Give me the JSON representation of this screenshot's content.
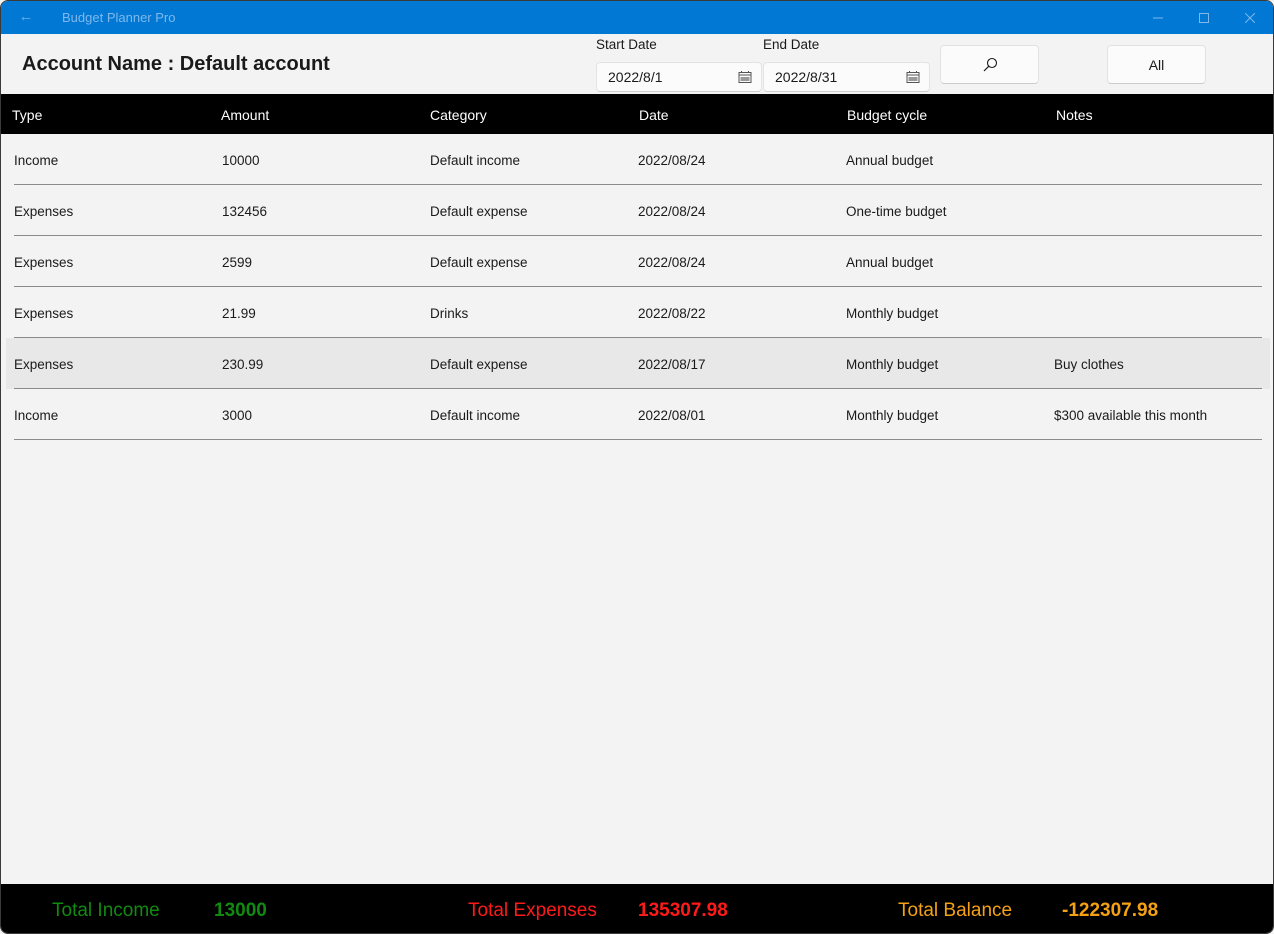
{
  "window": {
    "title": "Budget Planner Pro",
    "back_icon": "arrow-left-icon",
    "controls": [
      "minimize",
      "maximize",
      "close"
    ]
  },
  "header": {
    "account_title": "Account Name : Default account",
    "start_date": {
      "label": "Start Date",
      "value": "2022/8/1",
      "icon": "calendar-icon"
    },
    "end_date": {
      "label": "End Date",
      "value": "2022/8/31",
      "icon": "calendar-icon"
    },
    "search_button": {
      "icon": "search-icon"
    },
    "all_button": {
      "label": "All"
    }
  },
  "table": {
    "columns": [
      "Type",
      "Amount",
      "Category",
      "Date",
      "Budget cycle",
      "Notes"
    ],
    "rows": [
      {
        "type": "Income",
        "amount": "10000",
        "category": "Default income",
        "date": "2022/08/24",
        "cycle": "Annual budget",
        "notes": ""
      },
      {
        "type": "Expenses",
        "amount": "132456",
        "category": "Default expense",
        "date": "2022/08/24",
        "cycle": "One-time budget",
        "notes": ""
      },
      {
        "type": "Expenses",
        "amount": "2599",
        "category": "Default expense",
        "date": "2022/08/24",
        "cycle": "Annual budget",
        "notes": ""
      },
      {
        "type": "Expenses",
        "amount": "21.99",
        "category": "Drinks",
        "date": "2022/08/22",
        "cycle": "Monthly budget",
        "notes": ""
      },
      {
        "type": "Expenses",
        "amount": "230.99",
        "category": "Default expense",
        "date": "2022/08/17",
        "cycle": "Monthly budget",
        "notes": "Buy clothes",
        "selected": true
      },
      {
        "type": "Income",
        "amount": "3000",
        "category": "Default income",
        "date": "2022/08/01",
        "cycle": "Monthly budget",
        "notes": "$300 available this month"
      }
    ]
  },
  "footer": {
    "income": {
      "label": "Total Income",
      "value": "13000",
      "color": "#108a10"
    },
    "expenses": {
      "label": "Total Expenses",
      "value": "135307.98",
      "color": "#ff1a1a"
    },
    "balance": {
      "label": "Total Balance",
      "value": "-122307.98",
      "color": "#f5a114"
    }
  }
}
